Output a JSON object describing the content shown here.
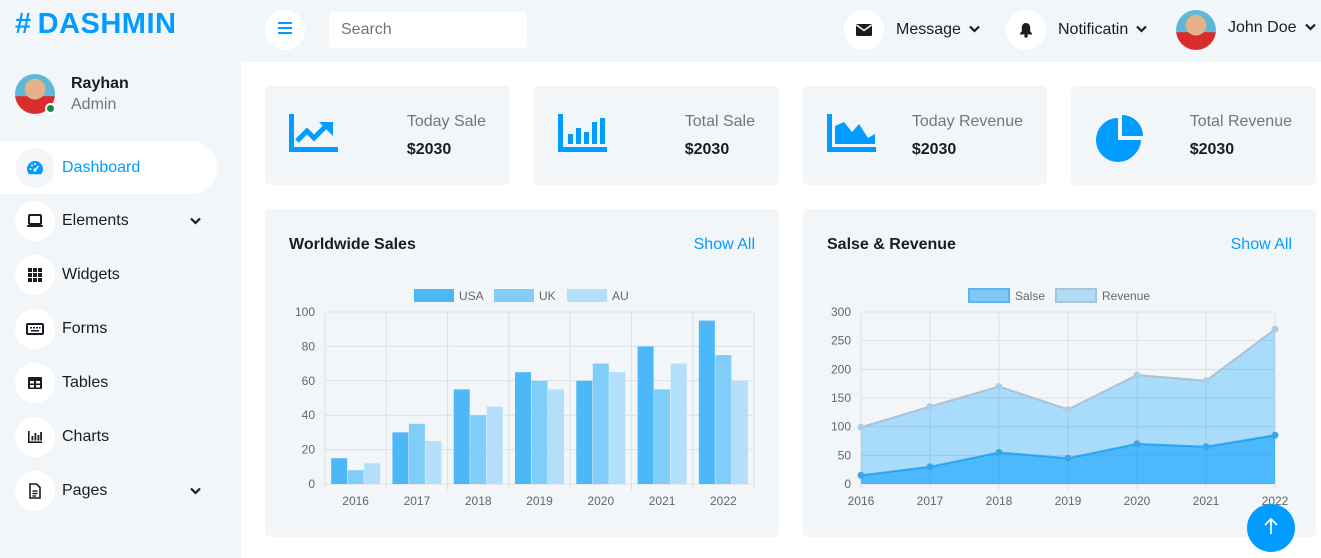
{
  "brand": {
    "hash": "#",
    "name": "DASHMIN"
  },
  "profile": {
    "name": "Rayhan",
    "role": "Admin"
  },
  "nav": [
    {
      "label": "Dashboard",
      "icon": "gauge-icon",
      "active": true,
      "caret": false
    },
    {
      "label": "Elements",
      "icon": "laptop-icon",
      "active": false,
      "caret": true
    },
    {
      "label": "Widgets",
      "icon": "grid-icon",
      "active": false,
      "caret": false
    },
    {
      "label": "Forms",
      "icon": "keyboard-icon",
      "active": false,
      "caret": false
    },
    {
      "label": "Tables",
      "icon": "table-icon",
      "active": false,
      "caret": false
    },
    {
      "label": "Charts",
      "icon": "chart-icon",
      "active": false,
      "caret": false
    },
    {
      "label": "Pages",
      "icon": "file-icon",
      "active": false,
      "caret": true
    }
  ],
  "topbar": {
    "search_placeholder": "Search",
    "message_label": "Message",
    "notification_label": "Notificatin",
    "user_name": "John Doe"
  },
  "stats": [
    {
      "title": "Today Sale",
      "value": "$2030",
      "icon": "line-chart-icon"
    },
    {
      "title": "Total Sale",
      "value": "$2030",
      "icon": "bar-chart-icon"
    },
    {
      "title": "Today Revenue",
      "value": "$2030",
      "icon": "area-chart-icon"
    },
    {
      "title": "Total Revenue",
      "value": "$2030",
      "icon": "pie-chart-icon"
    }
  ],
  "panels": {
    "worldwide": {
      "title": "Worldwide Sales",
      "link": "Show All"
    },
    "revenue": {
      "title": "Salse & Revenue",
      "link": "Show All"
    }
  },
  "colors": {
    "accent": "#009cff",
    "series1": "#4cb8f7",
    "series2": "#80cdf9",
    "series3": "#b3dffa"
  },
  "chart_data": [
    {
      "type": "bar",
      "categories": [
        "2016",
        "2017",
        "2018",
        "2019",
        "2020",
        "2021",
        "2022"
      ],
      "series": [
        {
          "name": "USA",
          "values": [
            15,
            30,
            55,
            65,
            60,
            80,
            95
          ]
        },
        {
          "name": "UK",
          "values": [
            8,
            35,
            40,
            60,
            70,
            55,
            75
          ]
        },
        {
          "name": "AU",
          "values": [
            12,
            25,
            45,
            55,
            65,
            70,
            60
          ]
        }
      ],
      "ylim": [
        0,
        100
      ],
      "yticks": [
        0,
        20,
        40,
        60,
        80,
        100
      ],
      "legend": "top-center",
      "grid": true
    },
    {
      "type": "area",
      "categories": [
        "2016",
        "2017",
        "2018",
        "2019",
        "2020",
        "2021",
        "2022"
      ],
      "series": [
        {
          "name": "Salse",
          "values": [
            15,
            30,
            55,
            45,
            70,
            65,
            85
          ]
        },
        {
          "name": "Revenue",
          "values": [
            99,
            135,
            170,
            130,
            190,
            180,
            270
          ]
        }
      ],
      "ylim": [
        0,
        300
      ],
      "yticks": [
        0,
        50,
        100,
        150,
        200,
        250,
        300
      ],
      "legend": "top-center",
      "grid": true
    }
  ]
}
